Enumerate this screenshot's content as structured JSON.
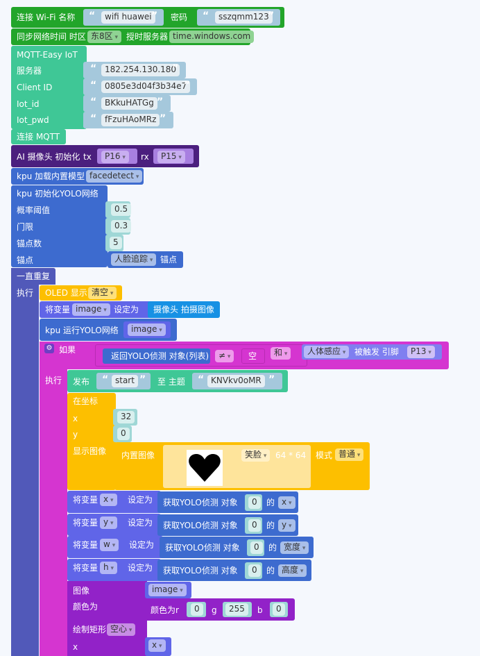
{
  "wifi": {
    "label": "连接 Wi-Fi 名称",
    "ssid": "wifi huawei",
    "pwd_label": "密码",
    "pwd": "sszqmm123"
  },
  "sync": {
    "label": "同步网络时间 时区",
    "zone": "东8区",
    "server_label": "授时服务器",
    "server": "time.windows.com"
  },
  "mqtt": {
    "title": "MQTT-Easy IoT",
    "server_label": "服务器",
    "server": "182.254.130.180",
    "client_label": "Client ID",
    "client": "0805e3d04f3b34e7",
    "id_label": "Iot_id",
    "id": "BKkuHATGg",
    "pwd_label": "Iot_pwd",
    "pwd": "fFzuHAoMRz",
    "connect": "连接 MQTT"
  },
  "camera": {
    "label": "AI 摄像头 初始化",
    "tx_label": "tx",
    "tx": "P16",
    "rx_label": "rx",
    "rx": "P15"
  },
  "kpu_load": {
    "label": "kpu 加载内置模型",
    "model": "facedetect"
  },
  "yolo_init": {
    "title": "kpu 初始化YOLO网络",
    "prob_label": "概率阈值",
    "prob": "0.5",
    "thresh_label": "门限",
    "thresh": "0.3",
    "anchors_num_label": "锚点数",
    "anchors_num": "5",
    "anchors_label": "锚点",
    "anchors": "人脸追踪",
    "anchors_suffix": "锚点"
  },
  "loop": {
    "title": "一直重复",
    "do": "执行"
  },
  "oled": {
    "label": "OLED 显示",
    "mode": "清空"
  },
  "set_image": {
    "label": "将变量",
    "var": "image",
    "set": "设定为",
    "value": "摄像头 拍摄图像"
  },
  "kpu_run": {
    "label": "kpu 运行YOLO网络",
    "var": "image"
  },
  "if_block": {
    "if": "如果",
    "do": "执行",
    "cond_left": "返回YOLO侦测 对象(列表)",
    "op": "≠",
    "cond_right": "空",
    "logic": "和",
    "sensor": "人体感应",
    "trigger": "被触发 引脚",
    "pin": "P13"
  },
  "publish": {
    "label": "发布",
    "msg": "start",
    "topic_label": "至 主题",
    "topic": "KNVkv0oMR"
  },
  "draw_img": {
    "title": "在坐标",
    "x_label": "x",
    "x": "32",
    "y_label": "y",
    "y": "0",
    "show_label": "显示图像",
    "builtin": "内置图像",
    "icon": "笑脸",
    "size": "64 * 64",
    "mode_label": "模式",
    "mode": "普通"
  },
  "sets": [
    {
      "label": "将变量",
      "var": "x",
      "set": "设定为",
      "get": "获取YOLO侦测 对象",
      "idx": "0",
      "of": "的",
      "prop": "x"
    },
    {
      "label": "将变量",
      "var": "y",
      "set": "设定为",
      "get": "获取YOLO侦测 对象",
      "idx": "0",
      "of": "的",
      "prop": "y"
    },
    {
      "label": "将变量",
      "var": "w",
      "set": "设定为",
      "get": "获取YOLO侦测 对象",
      "idx": "0",
      "of": "的",
      "prop": "宽度"
    },
    {
      "label": "将变量",
      "var": "h",
      "set": "设定为",
      "get": "获取YOLO侦测 对象",
      "idx": "0",
      "of": "的",
      "prop": "高度"
    }
  ],
  "rect": {
    "img_label": "图像",
    "img": "image",
    "color_label": "颜色为",
    "color_fn": "颜色为r",
    "r": "0",
    "g_label": "g",
    "g": "255",
    "b_label": "b",
    "b": "0",
    "draw_label": "绘制矩形",
    "fill": "空心",
    "x_label": "x",
    "x": "x"
  },
  "colors": {
    "green": "#22a52a",
    "mqtt": "#3fc796",
    "purple": "#4b1f7e",
    "blue": "#3d6bcf",
    "loop": "#5159b9",
    "oled": "#fdbf00",
    "setvar": "#6065e8",
    "if": "#d535d0",
    "text": "#a5c8dc"
  }
}
